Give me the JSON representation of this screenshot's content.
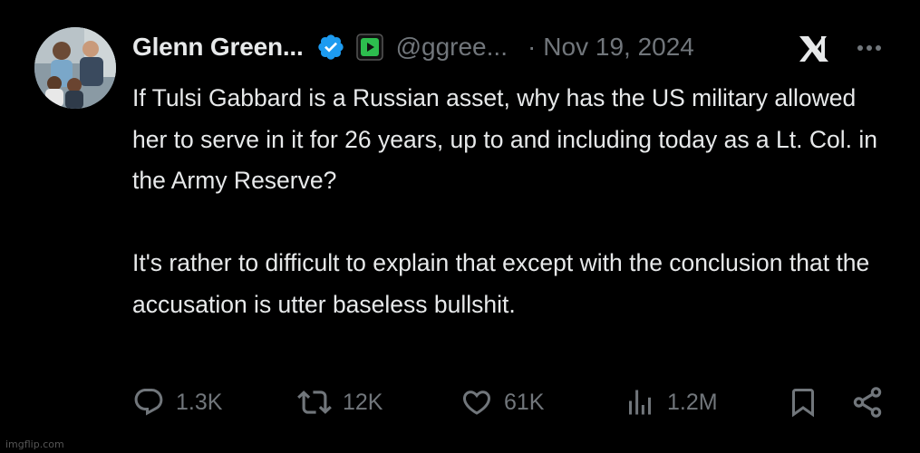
{
  "author": {
    "display_name": "Glenn Green...",
    "handle": "@ggree...",
    "separator": "·",
    "date": "Nov 19, 2024",
    "verified_color": "#1d9bf0",
    "affiliate_color": "#2dbd4e"
  },
  "tweet": {
    "paragraphs": [
      "If Tulsi Gabbard is a Russian asset, why has the US military allowed her to serve in it for 26 years, up to and including today as a Lt. Col. in the Army Reserve?",
      "It's rather to difficult to explain that except with the conclusion that the accusation is utter baseless bullshit."
    ]
  },
  "actions": {
    "replies": "1.3K",
    "reposts": "12K",
    "likes": "61K",
    "views": "1.2M"
  },
  "icons": {
    "header": [
      "verified-badge-icon",
      "affiliate-badge-icon",
      "grok-icon",
      "more-icon"
    ],
    "actions": [
      "reply-icon",
      "repost-icon",
      "like-icon",
      "views-icon",
      "bookmark-icon",
      "share-icon"
    ]
  },
  "colors": {
    "background": "#000000",
    "text_primary": "#e7e9ea",
    "text_secondary": "#71767b"
  },
  "watermark": "imgflip.com"
}
